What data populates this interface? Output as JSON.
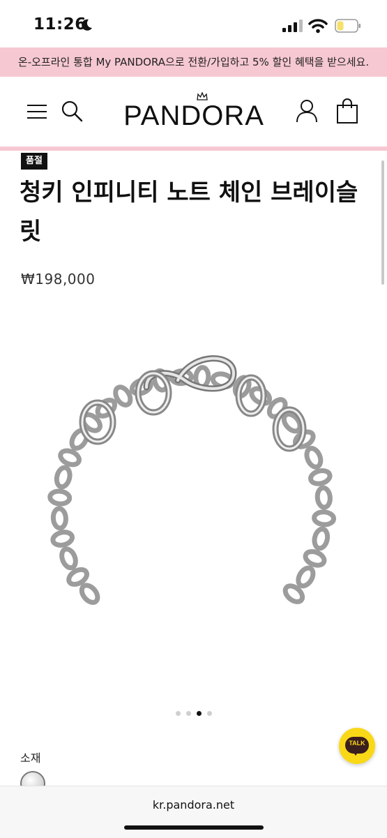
{
  "status_bar": {
    "time": "11:26",
    "icons": [
      "moon-icon",
      "cellular-signal-icon",
      "wifi-icon",
      "battery-icon"
    ]
  },
  "promo_banner": {
    "text": "온-오프라인 통합 My PANDORA으로 전환/가입하고 5% 할인 혜택을 받으세요.",
    "background": "#f6c8d2"
  },
  "header": {
    "logo": "PANDORA",
    "icons": [
      "menu-icon",
      "search-icon",
      "account-icon",
      "shopping-bag-icon"
    ]
  },
  "product": {
    "badge": "품절",
    "title": "청키 인피니티 노트 체인 브레이슬릿",
    "price": "₩198,000",
    "image": "silver-infinity-knot-chain-bracelet",
    "gallery": {
      "total": 4,
      "active_index": 2
    }
  },
  "options": {
    "material_label": "소재",
    "swatch": "silver"
  },
  "chat_button": {
    "label": "TALK",
    "color": "#f9d818"
  },
  "browser": {
    "url": "kr.pandora.net"
  }
}
